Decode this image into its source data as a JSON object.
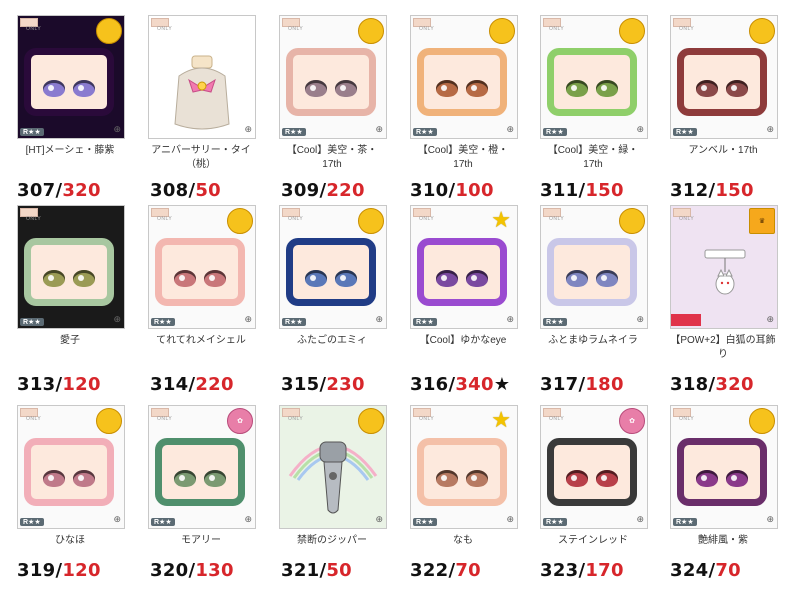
{
  "items": [
    {
      "label": "[HT]メーシェ・藤紫",
      "idx": "307",
      "val": "320",
      "mark": "",
      "frame": "#2a0a3a",
      "eye": "#8a7bd0",
      "badge": "2013",
      "kind": "face",
      "bg": "#1b0a2a"
    },
    {
      "label": "アニバーサリー・タイ（桃）",
      "idx": "308",
      "val": "50",
      "mark": "",
      "frame": "",
      "eye": "",
      "badge": "",
      "kind": "bottle",
      "bg": "#ffffff"
    },
    {
      "label": "【Cool】美空・茶・17th",
      "idx": "309",
      "val": "220",
      "mark": "",
      "frame": "#e7b4a8",
      "eye": "#9a7f8c",
      "badge": "17th",
      "kind": "face",
      "bg": "#fafafa"
    },
    {
      "label": "【Cool】美空・橙・17th",
      "idx": "310",
      "val": "100",
      "mark": "",
      "frame": "#f0b27a",
      "eye": "#b66a45",
      "badge": "17th",
      "kind": "face",
      "bg": "#fafafa"
    },
    {
      "label": "【Cool】美空・緑・17th",
      "idx": "311",
      "val": "150",
      "mark": "",
      "frame": "#8fcf6a",
      "eye": "#7aa04a",
      "badge": "17th",
      "kind": "face",
      "bg": "#fafafa"
    },
    {
      "label": "アンベル・17th",
      "idx": "312",
      "val": "150",
      "mark": "",
      "frame": "#8e3b3b",
      "eye": "#8b4a4a",
      "badge": "17th",
      "kind": "face",
      "bg": "#fafafa"
    },
    {
      "label": "愛子",
      "idx": "313",
      "val": "120",
      "mark": "",
      "frame": "#a8c7a0",
      "eye": "#9b9b55",
      "badge": "",
      "kind": "face",
      "bg": "#1a1a1a"
    },
    {
      "label": "てれてれメイシェル",
      "idx": "314",
      "val": "220",
      "mark": "",
      "frame": "#f3b7b0",
      "eye": "#c9777a",
      "badge": "12",
      "kind": "face",
      "bg": "#fafafa"
    },
    {
      "label": "ふたごのエミィ",
      "idx": "315",
      "val": "230",
      "mark": "",
      "frame": "#203c86",
      "eye": "#5a78b8",
      "badge": "12",
      "kind": "face",
      "bg": "#fafafa"
    },
    {
      "label": "【Cool】ゆかなeye",
      "idx": "316",
      "val": "340",
      "mark": "★",
      "frame": "#9a4bd0",
      "eye": "#7a4aa0",
      "badge": "star",
      "kind": "face",
      "bg": "#fafafa"
    },
    {
      "label": "ふとまゆラムネイラ",
      "idx": "317",
      "val": "180",
      "mark": "",
      "frame": "#c9c7e8",
      "eye": "#7f86c0",
      "badge": "1",
      "kind": "face",
      "bg": "#fafafa"
    },
    {
      "label": "【POW+2】白狐の耳飾り",
      "idx": "318",
      "val": "320",
      "mark": "",
      "frame": "",
      "eye": "",
      "badge": "crown",
      "kind": "charm",
      "bg": "#efe3f2"
    },
    {
      "label": "ひなほ",
      "idx": "319",
      "val": "120",
      "mark": "",
      "frame": "#f2aeb8",
      "eye": "#c07a8a",
      "badge": "3",
      "kind": "face",
      "bg": "#fafafa"
    },
    {
      "label": "モアリー",
      "idx": "320",
      "val": "130",
      "mark": "",
      "frame": "#4f8f6c",
      "eye": "#7b9a72",
      "badge": "pink",
      "kind": "face",
      "bg": "#fafafa"
    },
    {
      "label": "禁断のジッパー",
      "idx": "321",
      "val": "50",
      "mark": "",
      "frame": "",
      "eye": "",
      "badge": "2018",
      "kind": "zipper",
      "bg": "#eaf3e6"
    },
    {
      "label": "なも",
      "idx": "322",
      "val": "70",
      "mark": "",
      "frame": "#f4c0a8",
      "eye": "#b77a62",
      "badge": "star",
      "kind": "face",
      "bg": "#fafafa"
    },
    {
      "label": "ステインレッド",
      "idx": "323",
      "val": "170",
      "mark": "",
      "frame": "#3a3a3a",
      "eye": "#b8404a",
      "badge": "pink",
      "kind": "face",
      "bg": "#fafafa"
    },
    {
      "label": "艶緋風・紫",
      "idx": "324",
      "val": "70",
      "mark": "",
      "frame": "#6a2e6a",
      "eye": "#8a3a8a",
      "badge": "4",
      "kind": "face",
      "bg": "#fafafa"
    }
  ],
  "common": {
    "only_text": "ONLY",
    "sep": "/",
    "rank_text": "R★★"
  }
}
